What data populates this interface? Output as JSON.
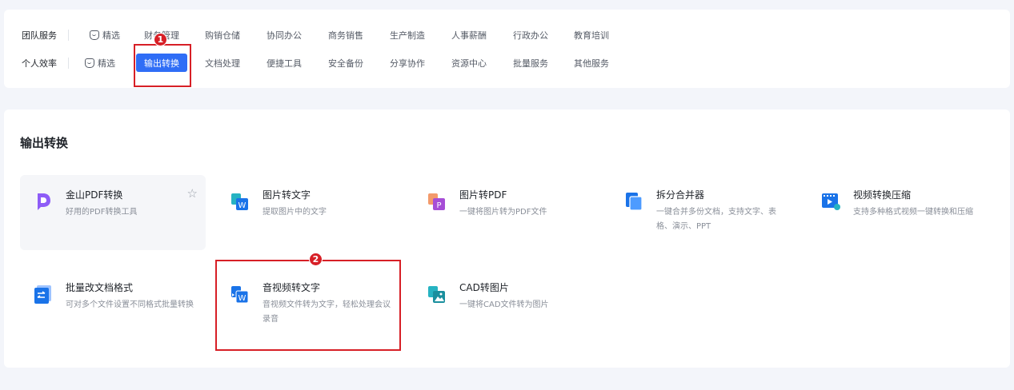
{
  "nav": {
    "team_row": {
      "label": "团队服务",
      "items": [
        "精选",
        "财务管理",
        "购销仓储",
        "协同办公",
        "商务销售",
        "生产制造",
        "人事薪酬",
        "行政办公",
        "教育培训"
      ]
    },
    "personal_row": {
      "label": "个人效率",
      "items": [
        "精选",
        "输出转换",
        "文档处理",
        "便捷工具",
        "安全备份",
        "分享协作",
        "资源中心",
        "批量服务",
        "其他服务"
      ],
      "active": "输出转换"
    }
  },
  "section": {
    "title": "输出转换",
    "tools": [
      {
        "name": "金山PDF转换",
        "desc": "好用的PDF转换工具",
        "icon": "kingsoft-pdf-icon"
      },
      {
        "name": "图片转文字",
        "desc": "提取图片中的文字",
        "icon": "image-to-text-icon"
      },
      {
        "name": "图片转PDF",
        "desc": "一键将图片转为PDF文件",
        "icon": "image-to-pdf-icon"
      },
      {
        "name": "拆分合并器",
        "desc": "一键合并多份文档，支持文字、表格、演示、PPT",
        "icon": "split-merge-icon"
      },
      {
        "name": "视频转换压缩",
        "desc": "支持多种格式视频一键转换和压缩",
        "icon": "video-convert-icon"
      },
      {
        "name": "批量改文档格式",
        "desc": "可对多个文件设置不同格式批量转换",
        "icon": "batch-format-icon"
      },
      {
        "name": "音视频转文字",
        "desc": "音视频文件转为文字，轻松处理会议录音",
        "icon": "audio-video-to-text-icon"
      },
      {
        "name": "CAD转图片",
        "desc": "一键将CAD文件转为图片",
        "icon": "cad-to-image-icon"
      }
    ]
  },
  "annotations": {
    "badge_1": "1",
    "badge_2": "2"
  },
  "colors": {
    "accent": "#2f6df6",
    "annotation": "#d71f26",
    "background": "#f3f5fa"
  }
}
